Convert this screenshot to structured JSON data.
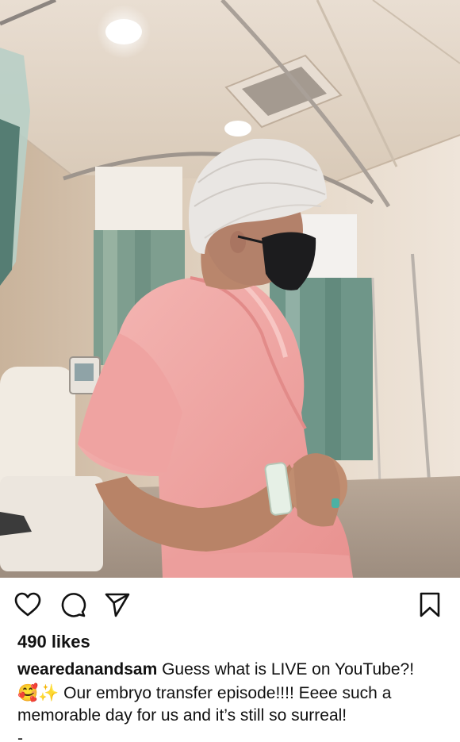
{
  "post": {
    "image_icon": "photo-hospital-room",
    "actions": {
      "like_icon": "heart-outline-icon",
      "comment_icon": "speech-bubble-icon",
      "share_icon": "paper-plane-icon",
      "save_icon": "bookmark-outline-icon"
    },
    "likes_text": "490 likes",
    "caption": {
      "username": "wearedanandsam",
      "text_line1": "Guess what is LIVE on YouTube?!",
      "emoji_1": "🥰",
      "emoji_2": "✨",
      "text_line2": "Our embryo transfer episode!!!! Eeee such a memorable day for us and it’s still so surreal!",
      "trailing": "-"
    }
  },
  "colors": {
    "text": "#111111",
    "background": "#ffffff",
    "gown": "#f2a9a8",
    "wall": "#d9c9b6"
  }
}
